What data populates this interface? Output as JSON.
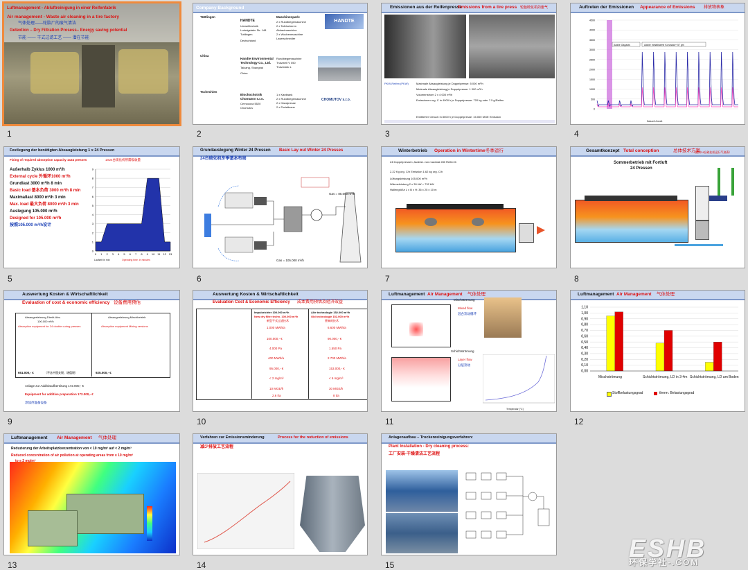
{
  "slides": [
    {
      "number": "1",
      "selected": true,
      "lines": [
        "Luftmanagement - Abluftreinigung in einer Reifenfabrik",
        "Air management - Waste air cleaning in a tire factory",
        "气体处理——轮胎厂的废气清洁",
        "Getextion – Dry Filtration Prosess– Energy saving potential",
        "节能 —— 干式过滤工艺 —— 潜在节能"
      ]
    },
    {
      "number": "2",
      "lines": [
        "Company Background",
        "Tüttlingen",
        "HANDTE",
        "Umwelttechnik",
        "Ludwigstaler Str. 148",
        "Tuttlingen",
        "Deutschland",
        "Maschinenpark:",
        "2 x Rundbiegemaschine",
        "2 x Tafelscheren",
        "Abkantmaschine",
        "2 x Wochenmaschine",
        "Laserschneider",
        "China",
        "Handte Environmental",
        "Technology Co., Ltd.",
        "Taicang, Shanghai",
        "China",
        "Rundbiegemaschine",
        "Trutzwelt V 050",
        "Trutzmatic L",
        "Tschechien",
        "Biochochotnik",
        "Chomutov s.r.o.",
        "Cernocová 5520",
        "Chomutov",
        "1 x Kantbank",
        "2 x Rundbiegemaschine",
        "2 x Handpresse",
        "2 x Portalkrane"
      ],
      "logos": [
        "HANDTE",
        "CHOMUTOV s.r.o."
      ]
    },
    {
      "number": "3",
      "lines": [
        "Emissionen aus der Reifenpresse",
        "Emissions from a tire press",
        "轮胎硫化机的废气",
        "PKW-Reifen (PKW)",
        "Maximale Absaugleistung je Doppelpresse: 5 000 m³/h",
        "Minimale Absaugleistung je Doppelpresse: 1 000 m³/h",
        "Volumenstrom 2 x 4 000 m³/h",
        "Emissionen org. C in 4000 h je Doppelpresse: 720 kg oder 7.5 g/Reifen",
        "Emittierter Geruch in 8000 h je Doppelpresse: 15.000 MGE Emission"
      ]
    },
    {
      "number": "4",
      "lines": [
        "Auftreten der Emissionen",
        "Appearance of Emissions",
        "排放物表象",
        "Addile Gagasts",
        "Addile metallisierte Konzstad+ 57 gm",
        "Datum/Uhrzeit"
      ],
      "yticks": [
        "4500",
        "4000",
        "3500",
        "3000",
        "2500",
        "2000",
        "1500",
        "1000",
        "500",
        "0"
      ]
    },
    {
      "number": "5",
      "lines": [
        "Festlegung der benötigten Absaugleistung 1 x 24 Pressen",
        "Fixing of required absorption capacity 1x24 presses",
        "1X24台硫化机所需吸收量",
        "Außerhalb Zyklus 1000 m³/h",
        "External cycle 外循环1000 m³/h",
        "Grundlast 3000 m³/h 8 min",
        "Basic load 基本负荷 3000 m³/h 8 min",
        "Maximallast 8000 m³/h 3 min",
        "Max. load 最大负荷 8000 m³/h 3 min",
        "Auslegung 105.000 m³/h",
        "Designed for 105.000 m³/h",
        "按照105.000 m³/h设计",
        "Laufzeit in min",
        "Operating time: in minutes"
      ],
      "chart_data": {
        "type": "area",
        "x": [
          0,
          1,
          2,
          3,
          4,
          5,
          6,
          7,
          8,
          9,
          10,
          11,
          12,
          13
        ],
        "values": [
          1,
          1,
          3,
          3,
          3,
          3,
          3,
          3,
          3,
          8,
          8,
          8,
          1,
          1
        ],
        "ylim": [
          0,
          9
        ],
        "xlim": [
          0,
          13
        ],
        "yticks": [
          "9",
          "8",
          "7",
          "6",
          "5",
          "4",
          "3",
          "2",
          "1",
          "0"
        ],
        "xticks": [
          "0",
          "1",
          "2",
          "3",
          "4",
          "5",
          "6",
          "7",
          "8",
          "9",
          "10",
          "11",
          "12",
          "13"
        ]
      }
    },
    {
      "number": "6",
      "lines": [
        "Grundauslegung Winter 24 Pressen",
        "Basic Lay out Winter 24 Presses",
        "24台硫化机冬季基本布局",
        "Gas = 85.000 m³/h",
        "Gas = 105.000 m³/h"
      ]
    },
    {
      "number": "7",
      "lines": [
        "Winterbetrieb",
        "Operation in Wintertime",
        "冬季运行",
        "24 Doppelpressen; Auslöst. von maximal 280 Reifen/h",
        "2.22 Kg org. C/h Emission 1.62 kg org. C/h",
        "Lüftungsleistung 105.000 m³/h",
        "Wärmeleistung 2 x 30 kW = 732 kW",
        "Hallengröße L x B x H: 35 x 25 x 10 m"
      ]
    },
    {
      "number": "8",
      "lines": [
        "Gesamtkonzept",
        "Total conception",
        "总体技术方案",
        "（提供24台硫化机运行气流表）",
        "Sommerbetrieb mit Fortluft",
        "24 Pressen"
      ]
    },
    {
      "number": "9",
      "lines": [
        "Auswertung Kosten & Wirtschaftlichkeit",
        "Evaluation of cost & economic efficiency",
        "设备费用预估",
        "Absaugerfahrung Direkt-Abs.",
        "100.000 m³/h",
        "Absorption equipment for 24 double curing presses",
        "Absaugerfahrung Mischbetrieb",
        "Absorption equipment Mixing versions",
        "651.000,- €",
        "（不含中国关税、增值税）",
        "925.000,- €",
        "Anlage zur Additivaufbereitung 172.000,- €",
        "Equipment for additive preparation 172.000,- €",
        "添加剂准备设备"
      ]
    },
    {
      "number": "10",
      "lines": [
        "Auswertung Kosten & Wirtschaftlichkeit",
        "Evaluation Cost & Economic Efficiency",
        "成本费用预估及经济效益",
        "Impulsrichter 100.000 m³/h",
        "New dry filter techn. 100.000 m³/h",
        "新型干式过滤技术",
        "Alte technologie 152.000 m³/h",
        "Old technologie 152.000 m³/h",
        "原来的技术",
        "1.000 MWh/a",
        "6.600 MWh/a",
        "100.000,- €",
        "90.000,- €",
        "4.000 Pa",
        "1.550 Pa",
        "400 MWh/a",
        "2.700 MWh/a",
        "95.000,- €",
        "153.000,- €",
        "< 2 mg/m³",
        "< 6 mg/m³",
        "10 MGE/h",
        "30 MGE/h",
        "2.6 t/a",
        "8 t/a"
      ]
    },
    {
      "number": "11",
      "lines": [
        "Luftmanagement",
        "Air Management",
        "气体处理",
        "Mischströmung",
        "Mixed flow",
        "混合流动循环",
        "Schichtströmung",
        "Layer flow",
        "分层流动",
        "Temperatur [°C]"
      ]
    },
    {
      "number": "12",
      "lines": [
        "Luftmanagement",
        "Air Management",
        "气体处理",
        "Mischströmung",
        "Schichtströmung, LD in 3-4m",
        "Schichtströmung, LD am Boden",
        "Stoffbelastungsgrad",
        "therm. Belastungsgrad"
      ],
      "chart_data": {
        "type": "bar",
        "categories": [
          "Mischströmung",
          "Schichtströmung, LD in 3-4m",
          "Schichtströmung, LD am Boden"
        ],
        "series": [
          {
            "name": "Stoffbelastungsgrad",
            "values": [
              0.95,
              0.48,
              0.15
            ]
          },
          {
            "name": "therm. Belastungsgrad",
            "values": [
              1.02,
              0.7,
              0.5
            ]
          }
        ],
        "ylim": [
          0,
          1.1
        ],
        "yticks": [
          "1,10",
          "1,00",
          "0,90",
          "0,80",
          "0,70",
          "0,60",
          "0,50",
          "0,40",
          "0,30",
          "0,20",
          "0,10",
          "0,00"
        ],
        "legend": "bottom"
      }
    },
    {
      "number": "13",
      "lines": [
        "Luftmanagement",
        "Air Management",
        "气体处理",
        "Reduzierung der Arbeitsplatzkonzentration von < 10 mg/m³ auf < 2 mg/m³",
        "Reduced concentration of air pollution at operating areas from ≤ 10 mg/m³",
        "to ≤ 2 mg/m³"
      ]
    },
    {
      "number": "14",
      "lines": [
        "Verfahren zur Emissionsminderung",
        "Process for the reduction of emissions",
        "减少排放工艺流程"
      ]
    },
    {
      "number": "15",
      "lines": [
        "Anlagenaufbau – Trockenreinigungsverfahren:",
        "Plant Installation - Dry cleaning process:",
        "工厂安装-干燥清洁工艺流程"
      ]
    }
  ],
  "watermark": {
    "logo": "ESHB",
    "sub": "环保学社-.COM"
  }
}
